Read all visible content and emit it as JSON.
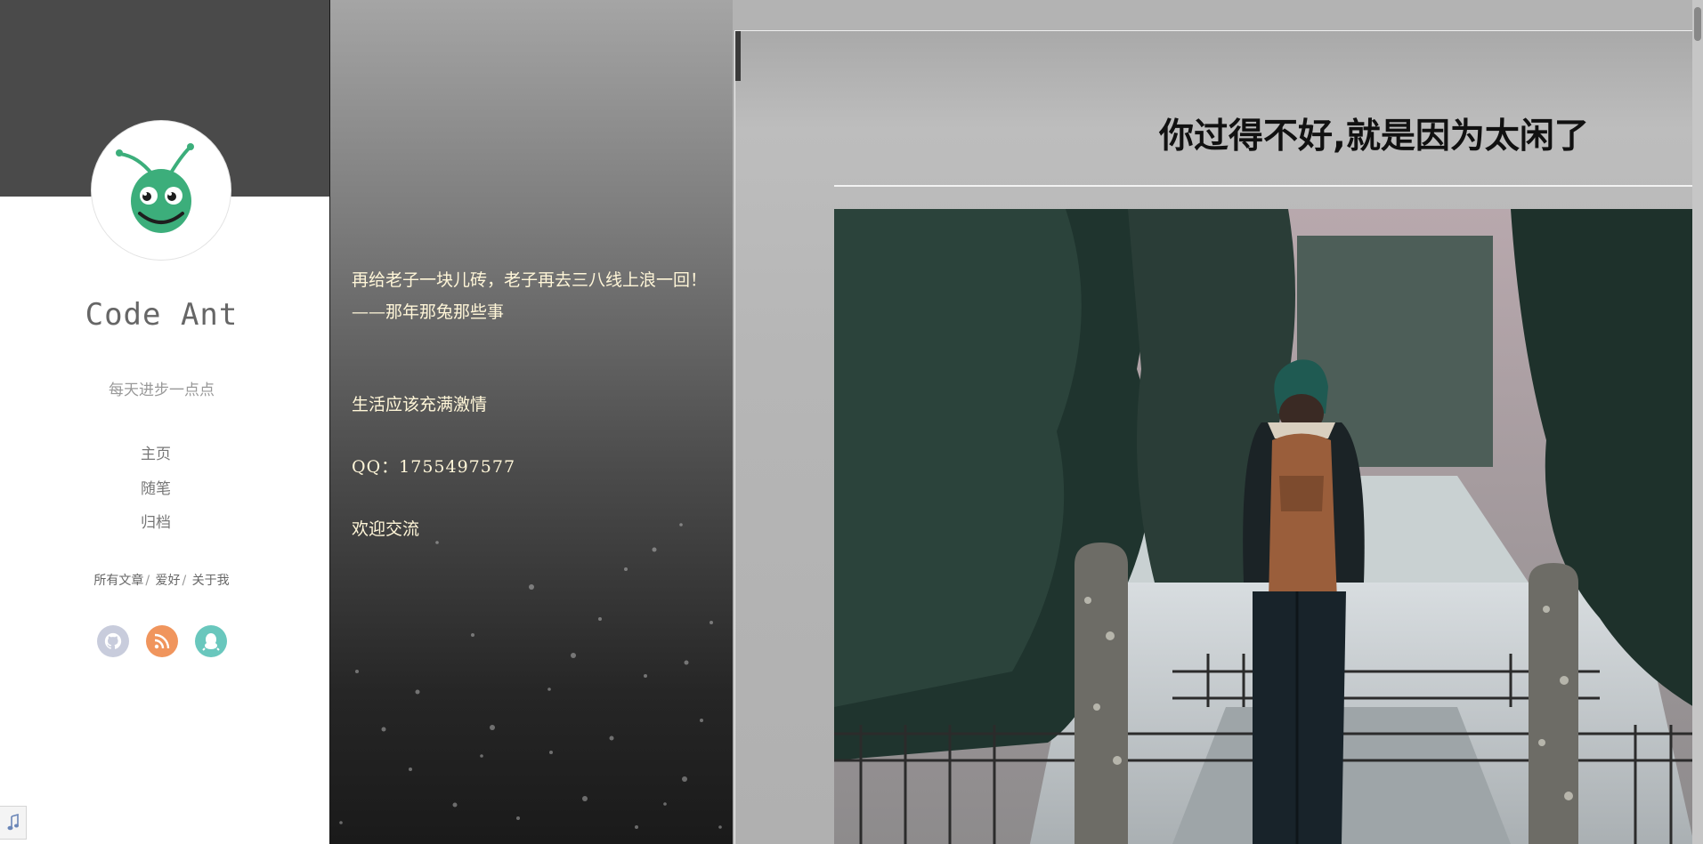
{
  "sidebar": {
    "site_name": "Code Ant",
    "motto": "每天进步一点点",
    "nav": [
      {
        "label": "主页"
      },
      {
        "label": "随笔"
      },
      {
        "label": "归档"
      }
    ],
    "sub_links": [
      {
        "label": "所有文章"
      },
      {
        "label": "爱好"
      },
      {
        "label": "关于我"
      }
    ],
    "separator": "/",
    "social": [
      {
        "icon": "github-icon",
        "color": "#c8ccdc"
      },
      {
        "icon": "rss-icon",
        "color": "#f0955d"
      },
      {
        "icon": "qq-icon",
        "color": "#69c7bd"
      }
    ],
    "avatar_icon": "ant-logo-icon",
    "accent_color": "#3cae7b"
  },
  "quotes": {
    "line1": "再给老子一块儿砖，老子再去三八线上浪一回！ ——那年那兔那些事",
    "line2": "生活应该充满激情",
    "line3": "QQ：1755497577",
    "line4": "欢迎交流"
  },
  "post": {
    "title": "你过得不好,就是因为太闲了",
    "image_icon": "cemetery-backpacker-photo"
  }
}
